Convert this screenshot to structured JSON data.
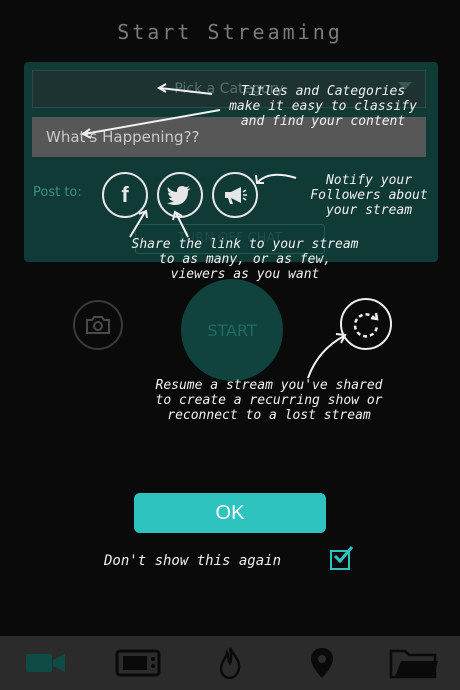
{
  "header": {
    "title": "Start Streaming"
  },
  "form": {
    "category_placeholder": "Pick a Category",
    "status_placeholder": "What's Happening??",
    "post_to_label": "Post to:",
    "share_targets": [
      "facebook-icon",
      "twitter-icon",
      "megaphone-icon"
    ],
    "chat_toggle_label": "TURN OFF CHAT"
  },
  "controls": {
    "start_label": "START"
  },
  "coachmarks": {
    "titles": "Titles and Categories\nmake it easy to classify\nand find your content",
    "notify": "Notify your\nFollowers about\nyour stream",
    "share": "Share the link to your stream\nto as many, or as few,\nviewers as you want",
    "resume": "Resume a stream you've shared\nto create a recurring show or\nreconnect to a lost stream"
  },
  "dialog": {
    "ok_label": "OK",
    "dont_show_label": "Don't show this again",
    "dont_show_checked": true
  },
  "tabbar": {
    "items": [
      "video-camera-icon",
      "tv-icon",
      "flame-icon",
      "map-pin-icon",
      "folder-icon"
    ],
    "active_index": 0
  },
  "colors": {
    "accent": "#2fc3c0",
    "panel": "#0f3a36",
    "tabbar": "#2b2b2b"
  }
}
